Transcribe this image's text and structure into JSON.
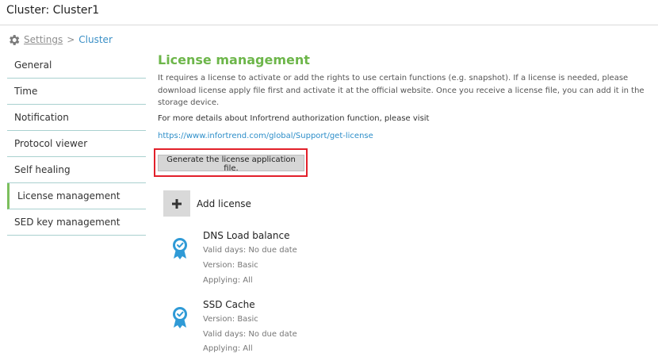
{
  "header": {
    "title": "Cluster: Cluster1"
  },
  "breadcrumb": {
    "settings": "Settings",
    "separator": ">",
    "current": "Cluster"
  },
  "sidebar": {
    "items": [
      {
        "label": "General"
      },
      {
        "label": "Time"
      },
      {
        "label": "Notification"
      },
      {
        "label": "Protocol viewer"
      },
      {
        "label": "Self healing"
      },
      {
        "label": "License management"
      },
      {
        "label": "SED key management"
      }
    ],
    "active_index": 5
  },
  "main": {
    "title": "License management",
    "description": "It requires a license to activate or add the rights to use certain functions (e.g. snapshot). If a license is needed, please download license apply file first and activate it at the official website. Once you receive a license file, you can add it in the storage device.",
    "more_text": "For more details about Infortrend authorization function, please visit",
    "link": "https://www.infortrend.com/global/Support/get-license",
    "generate_button": "Generate the license application file.",
    "add_license": "Add license",
    "licenses": [
      {
        "name": "DNS Load balance",
        "lines": [
          "Valid days: No due date",
          "Version: Basic",
          "Applying: All"
        ]
      },
      {
        "name": "SSD Cache",
        "lines": [
          "Version: Basic",
          "Valid days: No due date",
          "Applying: All"
        ]
      }
    ]
  },
  "colors": {
    "accent_green": "#6db64a",
    "link_blue": "#2d8ec9",
    "highlight_red": "#e2202a",
    "badge_blue": "#2f9ad6"
  }
}
